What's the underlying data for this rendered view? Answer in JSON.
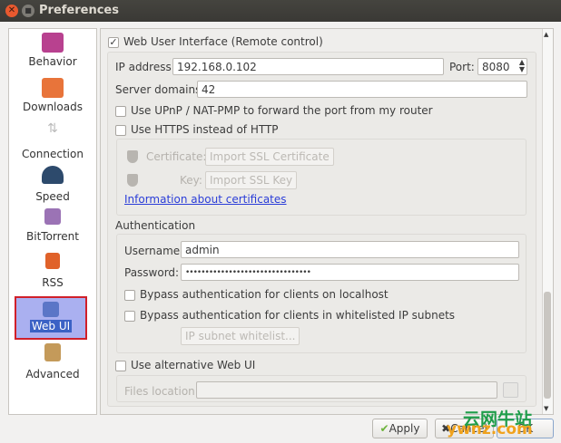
{
  "window": {
    "title": "Preferences"
  },
  "sidebar": {
    "items": [
      {
        "label": "Behavior"
      },
      {
        "label": "Downloads"
      },
      {
        "label": "Connection"
      },
      {
        "label": "Speed"
      },
      {
        "label": "BitTorrent"
      },
      {
        "label": "RSS"
      },
      {
        "label": "Web UI"
      },
      {
        "label": "Advanced"
      }
    ],
    "selected": "Web UI"
  },
  "webui": {
    "enable_label": "Web User Interface (Remote control)",
    "enabled": true,
    "ip_label": "IP address:",
    "ip_value": "192.168.0.102",
    "port_label": "Port:",
    "port_value": "8080",
    "domains_label": "Server domains:",
    "domains_value": "42",
    "upnp_label": "Use UPnP / NAT-PMP to forward the port from my router",
    "https_label": "Use HTTPS instead of HTTP",
    "cert_label": "Certificate:",
    "cert_button": "Import SSL Certificate",
    "key_label": "Key:",
    "key_button": "Import SSL Key",
    "cert_info_link": "Information about certificates",
    "auth_heading": "Authentication",
    "username_label": "Username:",
    "username_value": "admin",
    "password_label": "Password:",
    "password_value": "••••••••••••••••••••••••••••••••",
    "bypass_local_label": "Bypass authentication for clients on localhost",
    "bypass_whitelist_label": "Bypass authentication for clients in whitelisted IP subnets",
    "whitelist_button": "IP subnet whitelist...",
    "alt_webui_label": "Use alternative Web UI",
    "files_location_label": "Files location:",
    "files_location_value": ""
  },
  "buttons": {
    "apply": "Apply",
    "cancel": "Cancel",
    "ok": "OK"
  },
  "watermark": {
    "cn": "云网牛站",
    "en": "ywnz.com"
  }
}
